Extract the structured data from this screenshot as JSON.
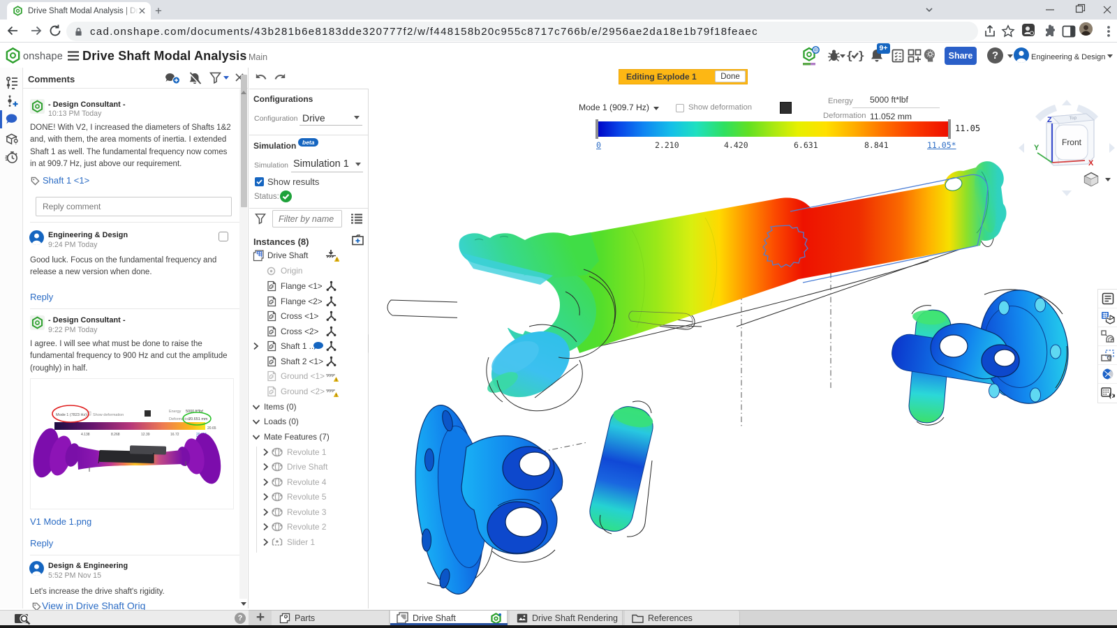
{
  "browser": {
    "tab_title": "Drive Shaft Modal Analysis | Driv",
    "url": "cad.onshape.com/documents/43b281b6e8183dde320777f2/w/f448158b20c955c8717c766b/e/2956ae2da18e1b79f18feaec"
  },
  "header": {
    "logo_text": "onshape",
    "document_title": "Drive Shaft Modal Analysis",
    "workspace": "Main",
    "notification_badge": "9+",
    "share_label": "Share",
    "account_name": "Engineering & Design"
  },
  "comments": {
    "title": "Comments",
    "reply_placeholder": "Reply comment",
    "items": [
      {
        "author": "- Design Consultant -",
        "time": "10:13 PM Today",
        "line1": "DONE!  With V2, I increased the diameters of Shafts 1&2",
        "line2": "and, with them, the area moments of inertia.  I extended",
        "line3": "Shaft 1 as well.  The fundamental frequency now comes",
        "line4": "in at 909.7 Hz, just above our requirement.",
        "tag": "Shaft 1 <1>"
      },
      {
        "author": "Engineering & Design",
        "time": "9:24 PM Today",
        "line1": "Good luck.  Focus on the fundamental frequency and",
        "line2": "release a new version when done.",
        "reply_label": "Reply"
      },
      {
        "author": "- Design Consultant -",
        "time": "9:22 PM Today",
        "line1": "I agree.  I will see what must be done to raise the",
        "line2": "fundamental frequency to 900 Hz and cut the amplitude",
        "line3": "(roughly) in half.",
        "attachment_label": "V1 Mode 1.png",
        "reply_label": "Reply"
      },
      {
        "author": "Design & Engineering",
        "time": "5:52 PM Nov 15",
        "line1": "Let's increase the drive shaft's rigidity.",
        "link": "View in Drive Shaft Orig"
      }
    ],
    "embedded_image": {
      "mode_label": "Mode 1 (7823 Hz)",
      "show_deformation": "Show deformation",
      "energy_label": "Energy",
      "energy_value": "5000 ft*lbf",
      "deformation_label": "Deformation",
      "deformation_value": "20.651 mm",
      "ticks": [
        "0",
        "4.138",
        "8.268",
        "12.39",
        "16.72",
        "20.651"
      ],
      "side_label": "20.65"
    }
  },
  "panel": {
    "configurations_title": "Configurations",
    "configuration_label": "Configuration",
    "configuration_value": "Drive",
    "simulation_title": "Simulation",
    "beta_badge": "beta",
    "simulation_label": "Simulation",
    "simulation_value": "Simulation 1",
    "show_results_label": "Show results",
    "status_label": "Status:",
    "filter_placeholder": "Filter by name",
    "instances_header": "Instances (8)",
    "root_item": "Drive Shaft",
    "origin_item": "Origin",
    "instances": [
      {
        "label": "Flange <1>"
      },
      {
        "label": "Flange <2>"
      },
      {
        "label": "Cross <1>"
      },
      {
        "label": "Cross <2>"
      },
      {
        "label": "Shaft 1 ..."
      },
      {
        "label": "Shaft 2 <1>"
      },
      {
        "label": "Ground <1>"
      },
      {
        "label": "Ground <2>"
      }
    ],
    "items_section": "Items (0)",
    "loads_section": "Loads (0)",
    "mates_section": "Mate Features (7)",
    "mate_features": [
      {
        "label": "Revolute 1"
      },
      {
        "label": "Drive Shaft"
      },
      {
        "label": "Revolute 4"
      },
      {
        "label": "Revolute 5"
      },
      {
        "label": "Revolute 3"
      },
      {
        "label": "Revolute 2"
      },
      {
        "label": "Slider 1"
      }
    ]
  },
  "viewport": {
    "banner_text": "Editing Explode 1",
    "done_label": "Done",
    "mode_label": "Mode 1 (909.7 Hz)",
    "show_deformation_label": "Show deformation",
    "energy_label": "Energy",
    "energy_value": "5000 ft*lbf",
    "deformation_label": "Deformation",
    "deformation_value": "11.052 mm",
    "scale_max_side": "11.05",
    "ticks": [
      "0",
      "2.210",
      "4.420",
      "6.631",
      "8.841",
      "11.05*"
    ],
    "view_cube": {
      "front": "Front",
      "top": "Top",
      "x": "X",
      "y": "Y",
      "z": "Z"
    }
  },
  "tabs": {
    "parts": "Parts",
    "drive_shaft": "Drive Shaft",
    "rendering": "Drive Shaft Rendering",
    "references": "References"
  },
  "colors": {
    "onshape_green": "#27a737",
    "accent_blue": "#2a5fc8",
    "link_blue": "#2a6bc4",
    "banner_yellow": "#fdb714",
    "status_green": "#1ea23a"
  }
}
